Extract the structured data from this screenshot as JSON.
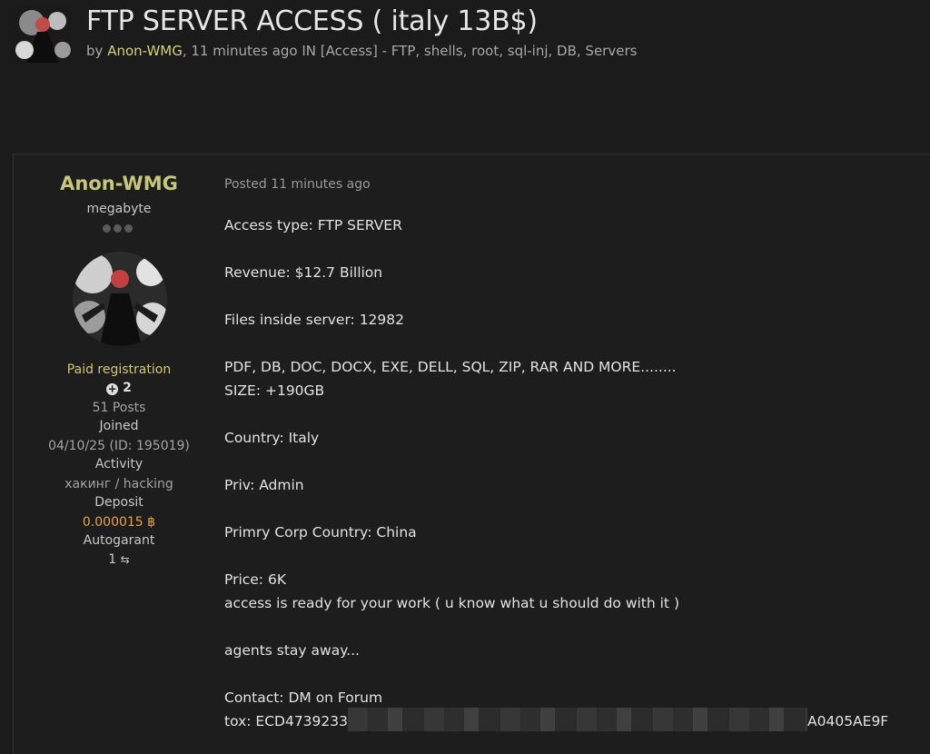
{
  "thread": {
    "title": "FTP SERVER ACCESS ( italy 13B$)",
    "by": "by",
    "author": "Anon-WMG",
    "meta_rest": ", 11 minutes ago IN [Access] - FTP, shells, root, sql-inj, DB, Servers"
  },
  "user": {
    "name": "Anon-WMG",
    "rank": "megabyte",
    "group": "Paid registration",
    "reputation": "2",
    "posts": "51 Posts",
    "joined_label": "Joined",
    "joined_value": "04/10/25 (ID: 195019)",
    "activity_label": "Activity",
    "activity_value": "хакинг / hacking",
    "deposit_label": "Deposit",
    "deposit_value": "0.000015",
    "autogarant_label": "Autogarant",
    "autogarant_value": "1"
  },
  "post": {
    "posted": "Posted 11 minutes ago",
    "lines": [
      "Access type: FTP SERVER",
      "Revenue: $12.7 Billion",
      "Files inside server: 12982",
      "PDF, DB, DOC, DOCX, EXE, DELL, SQL, ZIP, RAR AND MORE........",
      "SIZE: +190GB",
      "Country: Italy",
      "Priv: Admin",
      "Primry Corp Country: China",
      "Price: 6K",
      "access is ready for your work ( u know what u should do with it )",
      "agents stay away...",
      "Contact: DM on Forum"
    ],
    "tox_prefix": "tox: ECD4739233",
    "tox_suffix": "A0405AE9F"
  },
  "icons": {
    "reputation": "plus-circle-icon",
    "deposit": "bitcoin-icon",
    "autogarant": "handshake-icon"
  },
  "colors": {
    "background": "#1b1b1c",
    "username": "#c7c77c",
    "group": "#d5c76d",
    "deposit": "#e8a33d"
  }
}
